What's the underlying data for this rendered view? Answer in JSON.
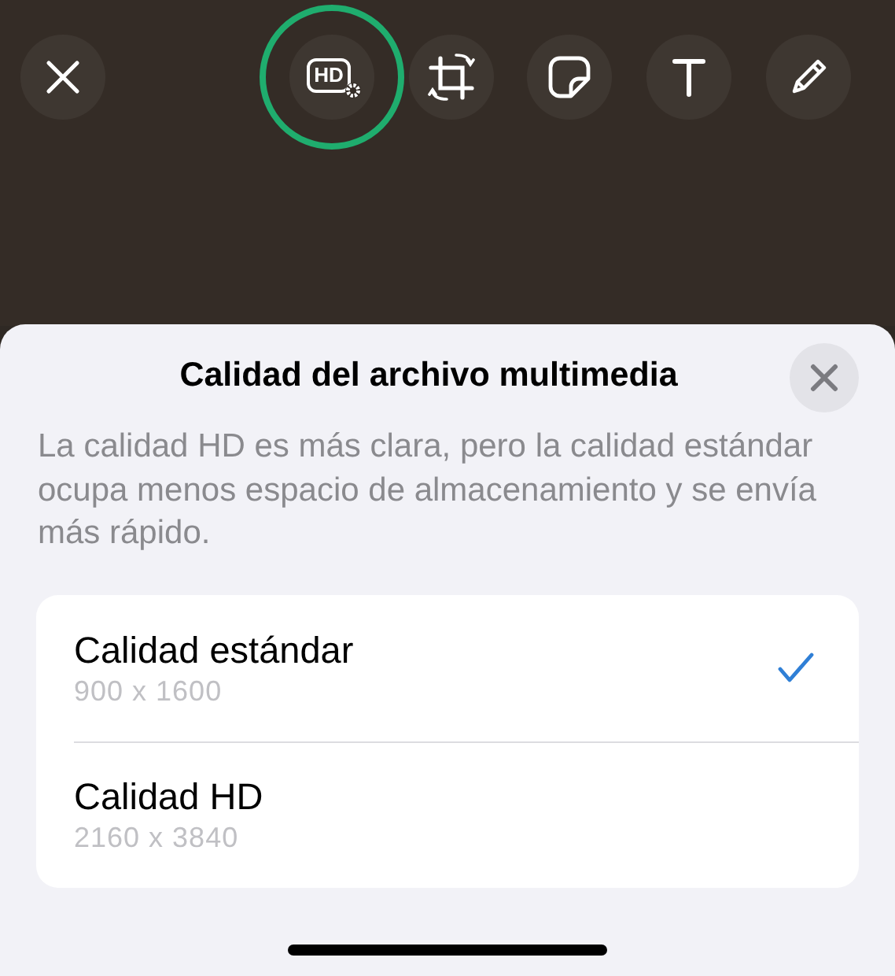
{
  "toolbar": {
    "tools": [
      {
        "kind": "close",
        "highlighted": false
      },
      {
        "kind": "hd",
        "label": "HD",
        "highlighted": true
      },
      {
        "kind": "crop",
        "highlighted": false
      },
      {
        "kind": "sticker",
        "highlighted": false
      },
      {
        "kind": "text",
        "highlighted": false
      },
      {
        "kind": "draw",
        "highlighted": false
      }
    ]
  },
  "sheet": {
    "title": "Calidad del archivo multimedia",
    "description": "La calidad HD es más clara, pero la calidad estándar ocupa menos espacio de almacenamiento y se envía más rápido.",
    "options": [
      {
        "label": "Calidad estándar",
        "resolution": "900 x 1600",
        "selected": true
      },
      {
        "label": "Calidad HD",
        "resolution": "2160 x 3840",
        "selected": false
      }
    ]
  }
}
